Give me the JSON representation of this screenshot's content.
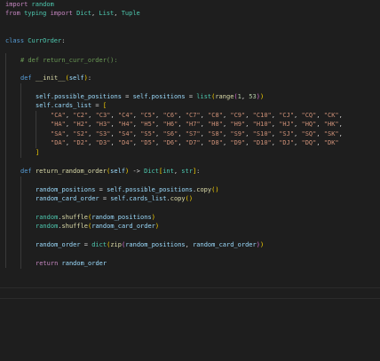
{
  "colors": {
    "background": "#1e1e1e",
    "keyword": "#c586c0",
    "storage_keyword": "#569cd6",
    "function": "#dcdcaa",
    "class_type": "#4ec9b0",
    "variable": "#9cdcfe",
    "string": "#ce9178",
    "number": "#b5cea8",
    "comment": "#6a9955",
    "bracket_1": "#ffd700",
    "bracket_2": "#da70d6",
    "bracket_3": "#179fff"
  },
  "code": {
    "l1": {
      "kw": "import",
      "mod": "random"
    },
    "l2": {
      "kw1": "from",
      "mod": "typing",
      "kw2": "import",
      "names": [
        "Dict",
        "List",
        "Tuple"
      ]
    },
    "l3": {
      "kw": "class",
      "name": "CurrOrder"
    },
    "l4": {
      "comment": "# def return_curr_order():"
    },
    "l5": {
      "kw": "def",
      "name": "__init__",
      "param": "self"
    },
    "l6": {
      "a": "self.possible_positions",
      "b": "self.positions",
      "fn": "list",
      "fn2": "range",
      "n1": "1",
      "n2": "53"
    },
    "l7": {
      "a": "self.cards_list"
    },
    "l8": [
      "\"CA\"",
      "\"C2\"",
      "\"C3\"",
      "\"C4\"",
      "\"C5\"",
      "\"C6\"",
      "\"C7\"",
      "\"C8\"",
      "\"C9\"",
      "\"C10\"",
      "\"CJ\"",
      "\"CQ\"",
      "\"CK\""
    ],
    "l9": [
      "\"HA\"",
      "\"H2\"",
      "\"H3\"",
      "\"H4\"",
      "\"H5\"",
      "\"H6\"",
      "\"H7\"",
      "\"H8\"",
      "\"H9\"",
      "\"H10\"",
      "\"HJ\"",
      "\"HQ\"",
      "\"HK\""
    ],
    "l10": [
      "\"SA\"",
      "\"S2\"",
      "\"S3\"",
      "\"S4\"",
      "\"S5\"",
      "\"S6\"",
      "\"S7\"",
      "\"S8\"",
      "\"S9\"",
      "\"S10\"",
      "\"SJ\"",
      "\"SQ\"",
      "\"SK\""
    ],
    "l11": [
      "\"DA\"",
      "\"D2\"",
      "\"D3\"",
      "\"D4\"",
      "\"D5\"",
      "\"D6\"",
      "\"D7\"",
      "\"D8\"",
      "\"D9\"",
      "\"D10\"",
      "\"DJ\"",
      "\"DQ\"",
      "\"DK\""
    ],
    "l13": {
      "kw": "def",
      "name": "return_random_order",
      "param": "self",
      "ret1": "Dict",
      "ret2": "int",
      "ret3": "str"
    },
    "l14": {
      "a": "random_positions",
      "b": "self.possible_positions",
      "fn": "copy"
    },
    "l15": {
      "a": "random_card_order",
      "b": "self.cards_list",
      "fn": "copy"
    },
    "l16": {
      "mod": "random",
      "fn": "shuffle",
      "arg": "random_positions"
    },
    "l17": {
      "mod": "random",
      "fn": "shuffle",
      "arg": "random_card_order"
    },
    "l18": {
      "a": "random_order",
      "fn1": "dict",
      "fn2": "zip",
      "arg1": "random_positions",
      "arg2": "random_card_order"
    },
    "l19": {
      "kw": "return",
      "v": "random_order"
    }
  }
}
